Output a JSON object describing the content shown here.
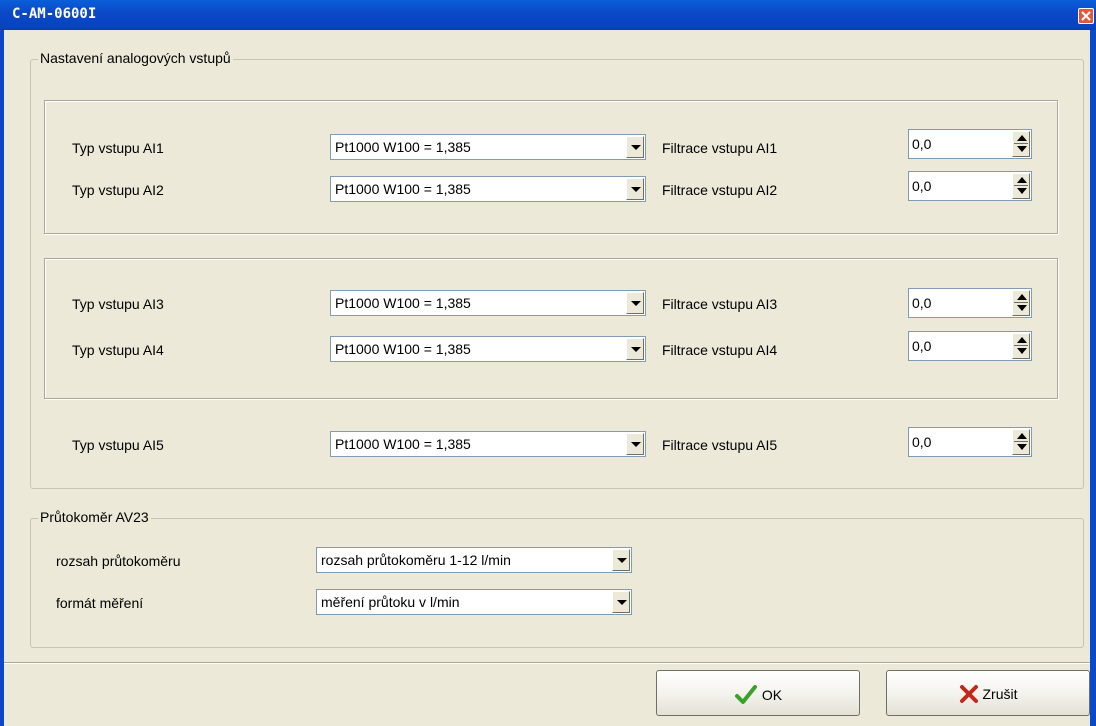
{
  "window": {
    "title": "C-AM-0600I"
  },
  "analog_group": {
    "legend": "Nastavení analogových vstupů",
    "inputs": [
      {
        "label": "Typ vstupu AI1",
        "value": "Pt1000 W100 = 1,385",
        "filter_label": "Filtrace vstupu AI1",
        "filter_value": "0,0"
      },
      {
        "label": "Typ vstupu AI2",
        "value": "Pt1000 W100 = 1,385",
        "filter_label": "Filtrace vstupu AI2",
        "filter_value": "0,0"
      },
      {
        "label": "Typ vstupu AI3",
        "value": "Pt1000 W100 = 1,385",
        "filter_label": "Filtrace vstupu AI3",
        "filter_value": "0,0"
      },
      {
        "label": "Typ vstupu AI4",
        "value": "Pt1000 W100 = 1,385",
        "filter_label": "Filtrace vstupu AI4",
        "filter_value": "0,0"
      },
      {
        "label": "Typ vstupu AI5",
        "value": "Pt1000 W100 = 1,385",
        "filter_label": "Filtrace vstupu AI5",
        "filter_value": "0,0"
      }
    ]
  },
  "flow_group": {
    "legend": "Průtokoměr AV23",
    "range_label": "rozsah průtokoměru",
    "range_value": "rozsah průtokoměru 1-12 l/min",
    "format_label": "formát měření",
    "format_value": "měření průtoku v l/min"
  },
  "buttons": {
    "ok_label": "OK",
    "cancel_label": "Zrušit"
  },
  "colors": {
    "title_bar": "#0a49c9",
    "dialog_bg": "#ece9d8",
    "ok_check": "#3aa12a",
    "cancel_x": "#c0281c"
  }
}
